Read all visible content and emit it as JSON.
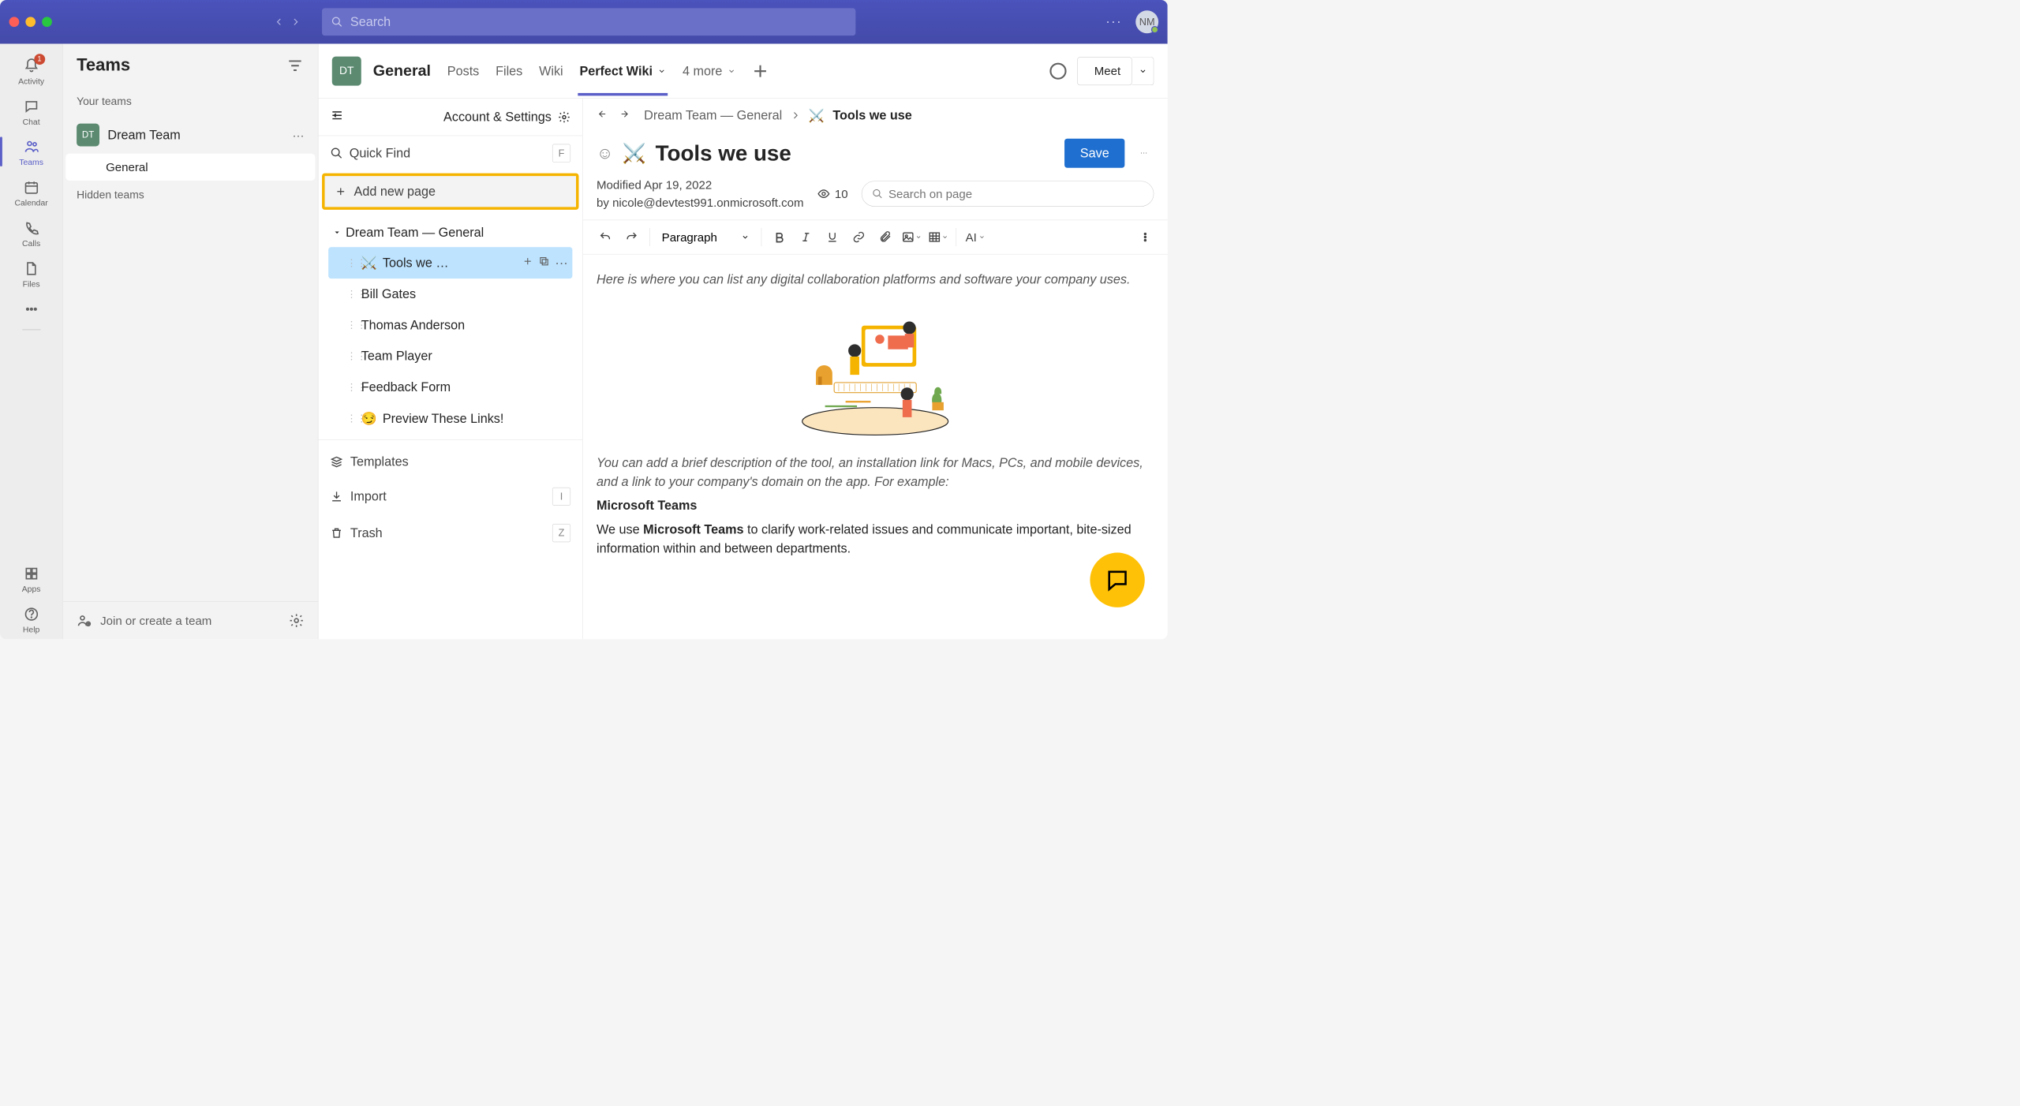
{
  "titlebar": {
    "search_placeholder": "Search",
    "avatar_initials": "NM"
  },
  "rail": {
    "activity": "Activity",
    "activity_badge": "1",
    "chat": "Chat",
    "teams": "Teams",
    "calendar": "Calendar",
    "calls": "Calls",
    "files": "Files",
    "apps": "Apps",
    "help": "Help"
  },
  "teams_panel": {
    "title": "Teams",
    "your_teams": "Your teams",
    "team_initials": "DT",
    "team_name": "Dream Team",
    "channel": "General",
    "hidden": "Hidden teams",
    "footer": "Join or create a team"
  },
  "chan": {
    "avatar": "DT",
    "title": "General",
    "tabs": {
      "posts": "Posts",
      "files": "Files",
      "wiki": "Wiki",
      "perfect": "Perfect Wiki",
      "more": "4 more"
    },
    "meet": "Meet"
  },
  "wiki": {
    "account": "Account & Settings",
    "quick_find": "Quick Find",
    "quick_find_key": "F",
    "add_page": "Add new page",
    "tree_root": "Dream Team — General",
    "items": [
      {
        "icon": "⚔️",
        "label": "Tools we …"
      },
      {
        "icon": "",
        "label": "Bill Gates"
      },
      {
        "icon": "",
        "label": "Thomas Anderson"
      },
      {
        "icon": "",
        "label": "Team Player"
      },
      {
        "icon": "",
        "label": "Feedback Form"
      },
      {
        "icon": "😏",
        "label": "Preview These Links!"
      }
    ],
    "templates": "Templates",
    "import": "Import",
    "import_key": "I",
    "trash": "Trash",
    "trash_key": "Z"
  },
  "crumb": {
    "path1": "Dream Team — General",
    "current": "Tools we use"
  },
  "page": {
    "emoji": "⚔️",
    "title": "Tools we use",
    "save": "Save",
    "modified": "Modified Apr 19, 2022",
    "by": "by nicole@devtest991.onmicrosoft.com",
    "views": "10",
    "search_placeholder": "Search on page"
  },
  "toolbar": {
    "style": "Paragraph"
  },
  "body": {
    "p1": "Here is where you can list any digital collaboration platforms and software your company uses.",
    "p2": "You can add a brief description of the tool, an installation link for Macs, PCs, and mobile devices, and a link to your company's domain on the app. For example:",
    "h1": "Microsoft Teams",
    "p3a": "We use ",
    "p3b": "Microsoft Teams",
    "p3c": " to clarify work-related issues and communicate important, bite-sized information within and between departments."
  }
}
